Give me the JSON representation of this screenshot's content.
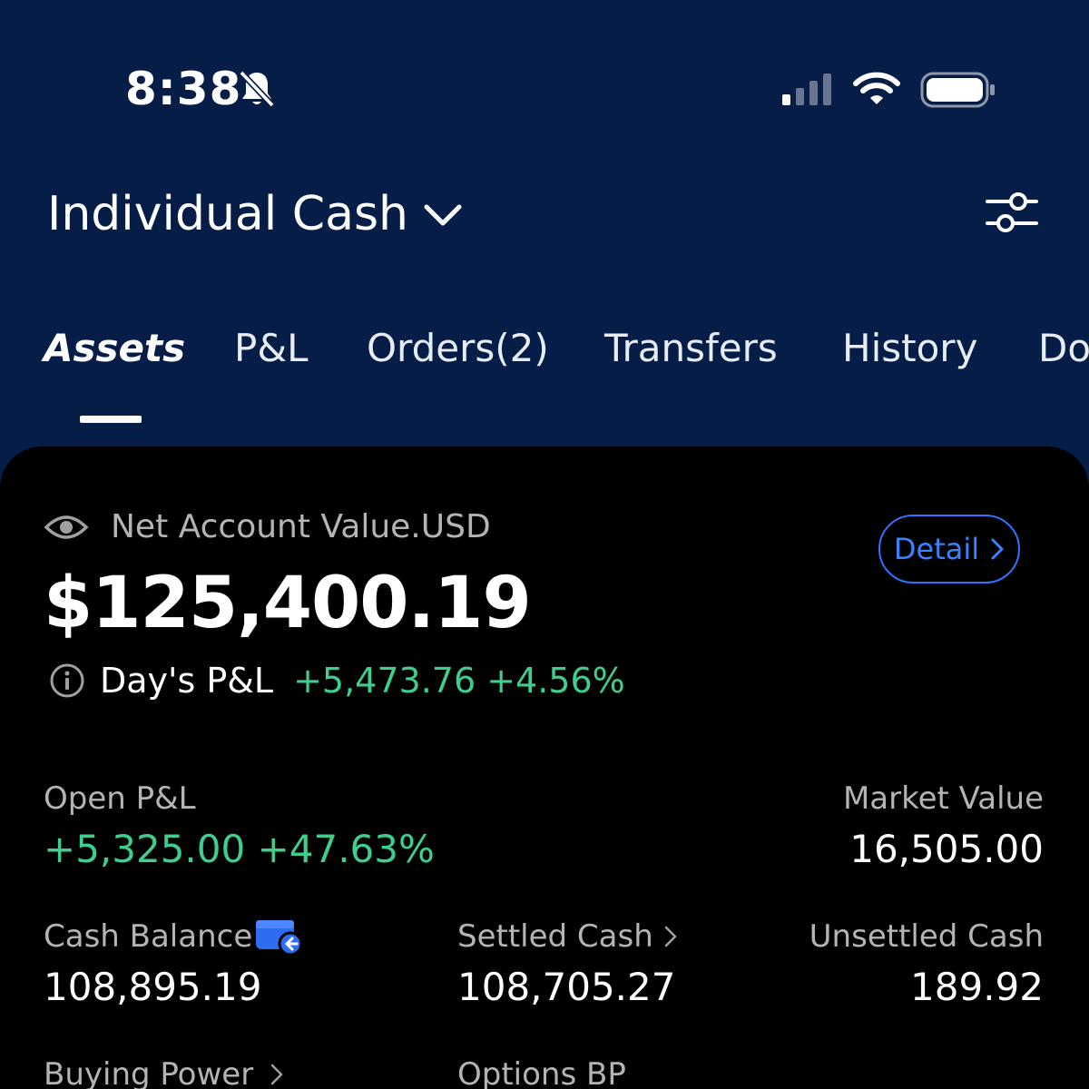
{
  "status_bar": {
    "time": "8:38",
    "icons": [
      "bell-slash-icon",
      "signal-icon",
      "wifi-icon",
      "battery-icon"
    ]
  },
  "header": {
    "account_name": "Individual Cash",
    "icons": [
      "chevron-down-icon",
      "filter-sliders-icon"
    ]
  },
  "tabs": [
    {
      "label": "Assets",
      "active": true
    },
    {
      "label": "P&L",
      "active": false
    },
    {
      "label": "Orders(2)",
      "active": false
    },
    {
      "label": "Transfers",
      "active": false
    },
    {
      "label": "History",
      "active": false
    },
    {
      "label": "Do",
      "active": false
    }
  ],
  "summary": {
    "net_label": "Net Account Value.USD",
    "net_value": "$125,400.19",
    "detail_button": "Detail",
    "days_pl_label": "Day's P&L",
    "days_pl_value": "+5,473.76 +4.56%"
  },
  "stats": {
    "open_pl": {
      "label": "Open P&L",
      "value": "+5,325.00 +47.63%"
    },
    "market_value": {
      "label": "Market Value",
      "value": "16,505.00"
    },
    "cash_balance": {
      "label": "Cash Balance",
      "value": "108,895.19"
    },
    "settled_cash": {
      "label": "Settled Cash",
      "value": "108,705.27"
    },
    "unsettled_cash": {
      "label": "Unsettled Cash",
      "value": "189.92"
    },
    "buying_power": {
      "label": "Buying Power"
    },
    "options_bp": {
      "label": "Options BP"
    }
  },
  "colors": {
    "header_bg": "#061d47",
    "card_bg": "#000000",
    "positive": "#3ecf8e",
    "accent": "#2f73ff"
  }
}
